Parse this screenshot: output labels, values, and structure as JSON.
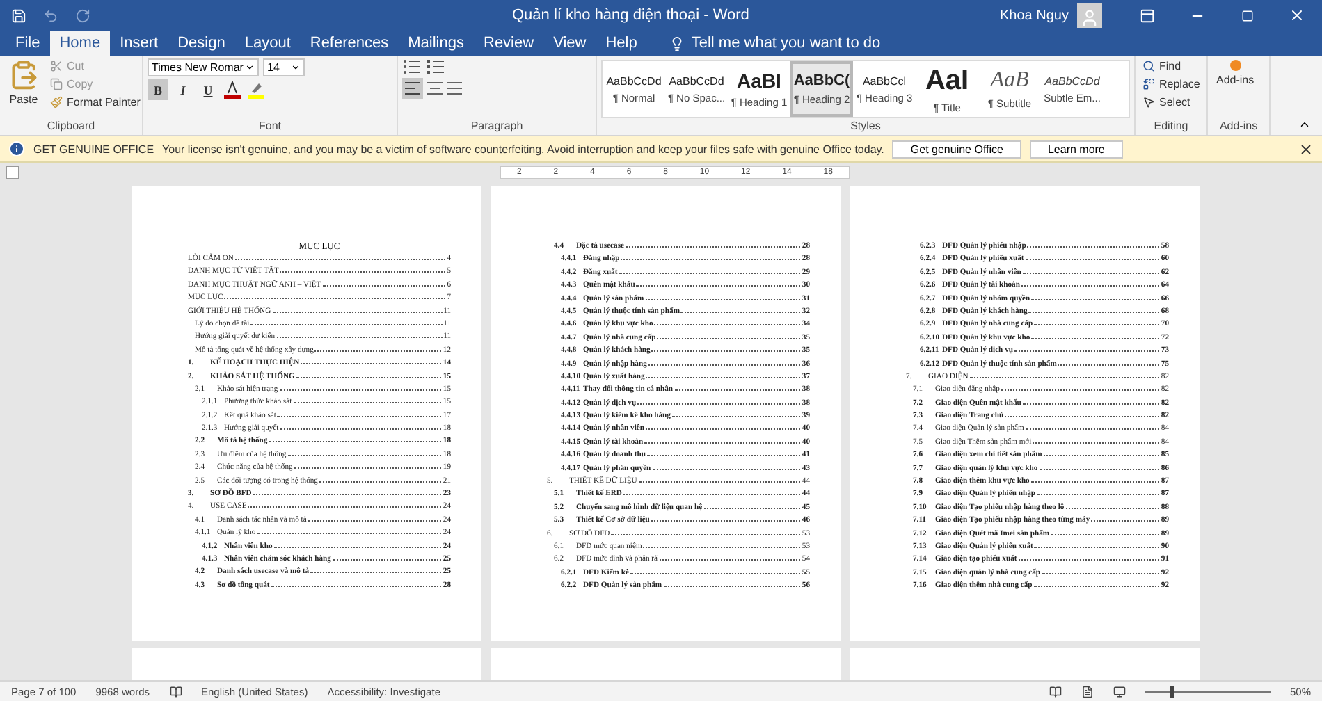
{
  "window": {
    "title": "Quản lí kho hàng điện thoại  -  Word",
    "user": "Khoa Nguy"
  },
  "tabs": [
    {
      "label": "File",
      "selected": false
    },
    {
      "label": "Home",
      "selected": true
    },
    {
      "label": "Insert",
      "selected": false
    },
    {
      "label": "Design",
      "selected": false
    },
    {
      "label": "Layout",
      "selected": false
    },
    {
      "label": "References",
      "selected": false
    },
    {
      "label": "Mailings",
      "selected": false
    },
    {
      "label": "Review",
      "selected": false
    },
    {
      "label": "View",
      "selected": false
    },
    {
      "label": "Help",
      "selected": false
    }
  ],
  "tell_me": "Tell me what you want to do",
  "ribbon": {
    "clipboard": {
      "paste": "Paste",
      "cut": "Cut",
      "copy": "Copy",
      "format_painter": "Format Painter",
      "label": "Clipboard"
    },
    "font": {
      "name": "Times New Romar",
      "size": "14",
      "label": "Font",
      "format": [
        {
          "label": "B",
          "kind": "bold",
          "on": true
        },
        {
          "label": "I",
          "kind": "italic",
          "on": false
        },
        {
          "label": "U",
          "kind": "underline",
          "on": false
        }
      ]
    },
    "paragraph": {
      "label": "Paragraph",
      "align_left": true
    },
    "styles": {
      "label": "Styles",
      "items": [
        {
          "preview": "AaBbCcDd",
          "name": "¶ Normal",
          "kind": "normal",
          "selected": false
        },
        {
          "preview": "AaBbCcDd",
          "name": "¶ No Spac...",
          "kind": "normal",
          "selected": false
        },
        {
          "preview": "AaBI",
          "name": "¶ Heading 1",
          "kind": "heavy",
          "selected": false
        },
        {
          "preview": "AaBbC(",
          "name": "¶ Heading 2",
          "kind": "bold",
          "selected": true
        },
        {
          "preview": "AaBbCcl",
          "name": "¶ Heading 3",
          "kind": "normal",
          "selected": false
        },
        {
          "preview": "AaI",
          "name": "¶ Title",
          "kind": "title",
          "selected": false
        },
        {
          "preview": "AaB",
          "name": "¶ Subtitle",
          "kind": "italic",
          "selected": false
        },
        {
          "preview": "AaBbCcDd",
          "name": "Subtle Em...",
          "kind": "small-italic",
          "selected": false
        }
      ]
    },
    "editing": {
      "label": "Editing",
      "find": "Find",
      "replace": "Replace",
      "select": "Select"
    },
    "addins": {
      "button": "Add-ins",
      "label": "Add-ins"
    }
  },
  "info_bar": {
    "title": "GET GENUINE OFFICE",
    "message": "Your license isn't genuine, and you may be a victim of software counterfeiting. Avoid interruption and keep your files safe with genuine Office today.",
    "buttons": [
      "Get genuine Office",
      "Learn more"
    ]
  },
  "ruler": [
    "2",
    "2",
    "4",
    "6",
    "8",
    "10",
    "12",
    "14",
    "18"
  ],
  "pages": [
    {
      "heading": "MỤC LỤC",
      "entries": [
        {
          "title": "LỜI CẢM ƠN",
          "page": "4",
          "kind": "top",
          "bold": false
        },
        {
          "title": "DANH MỤC TỪ VIẾT TẮT",
          "page": "5",
          "kind": "top",
          "bold": false
        },
        {
          "title": "DANH MỤC THUẬT NGỮ ANH – VIỆT",
          "page": "6",
          "kind": "top",
          "bold": false
        },
        {
          "title": "MỤC LỤC",
          "page": "7",
          "kind": "top",
          "bold": false
        },
        {
          "title": "GIỚI THIỆU HỆ THỐNG",
          "page": "11",
          "kind": "top",
          "bold": false
        },
        {
          "title": "Lý do chọn đề tài",
          "page": "11",
          "kind": "sub",
          "bold": false
        },
        {
          "title": "Hướng giải quyết dự kiến",
          "page": "11",
          "kind": "sub",
          "bold": false
        },
        {
          "title": "Mô tả tổng quát về hệ thống xây dựng",
          "page": "12",
          "kind": "sub",
          "bold": false
        },
        {
          "num": "1.",
          "title": "KẾ HOẠCH THỰC HIỆN",
          "page": "14",
          "kind": "top",
          "bold": true
        },
        {
          "num": "2.",
          "title": "KHẢO SÁT HỆ THỐNG",
          "page": "15",
          "kind": "top",
          "bold": true
        },
        {
          "num": "2.1",
          "title": "Khảo sát hiện trạng",
          "page": "15",
          "kind": "sub",
          "bold": false
        },
        {
          "num": "2.1.1",
          "title": "Phương thức khảo sát",
          "page": "15",
          "kind": "subsub",
          "bold": false
        },
        {
          "num": "2.1.2",
          "title": "Kết quả khảo sát",
          "page": "17",
          "kind": "subsub",
          "bold": false
        },
        {
          "num": "2.1.3",
          "title": "Hướng giải quyết",
          "page": "18",
          "kind": "subsub",
          "bold": false
        },
        {
          "num": "2.2",
          "title": "Mô tả hệ thống",
          "page": "18",
          "kind": "sub",
          "bold": true
        },
        {
          "num": "2.3",
          "title": "Ưu điểm của hệ thống",
          "page": "18",
          "kind": "sub",
          "bold": false
        },
        {
          "num": "2.4",
          "title": "Chức năng của hệ thống",
          "page": "19",
          "kind": "sub",
          "bold": false
        },
        {
          "num": "2.5",
          "title": "Các đối tượng có trong hệ thống",
          "page": "21",
          "kind": "sub",
          "bold": false
        },
        {
          "num": "3.",
          "title": "SƠ ĐỒ BFD",
          "page": "23",
          "kind": "top",
          "bold": true
        },
        {
          "num": "4.",
          "title": "USE CASE",
          "page": "24",
          "kind": "top",
          "bold": false
        },
        {
          "num": "4.1",
          "title": "Danh sách tác nhân và mô tả",
          "page": "24",
          "kind": "sub",
          "bold": false
        },
        {
          "num": "4.1.1",
          "title": "Quản lý kho",
          "page": "24",
          "kind": "sub",
          "bold": false
        },
        {
          "num": "4.1.2",
          "title": "Nhân viên kho",
          "page": "24",
          "kind": "subsub",
          "bold": true
        },
        {
          "num": "4.1.3",
          "title": "Nhân viên chăm sóc khách hàng",
          "page": "25",
          "kind": "subsub",
          "bold": true
        },
        {
          "num": "4.2",
          "title": "Danh sách usecase và mô tả",
          "page": "25",
          "kind": "sub",
          "bold": true
        },
        {
          "num": "4.3",
          "title": "Sơ đồ tổng quát",
          "page": "28",
          "kind": "sub",
          "bold": true
        }
      ]
    },
    {
      "entries": [
        {
          "num": "4.4",
          "title": "Đặc tả usecase",
          "page": "28",
          "kind": "sub",
          "bold": true
        },
        {
          "num": "4.4.1",
          "title": "Đăng nhập",
          "page": "28",
          "kind": "subsub",
          "bold": true
        },
        {
          "num": "4.4.2",
          "title": "Đăng xuất",
          "page": "29",
          "kind": "subsub",
          "bold": true
        },
        {
          "num": "4.4.3",
          "title": "Quên mật khẩu",
          "page": "30",
          "kind": "subsub",
          "bold": true
        },
        {
          "num": "4.4.4",
          "title": "Quản lý sản phẩm",
          "page": "31",
          "kind": "subsub",
          "bold": true
        },
        {
          "num": "4.4.5",
          "title": "Quản lý thuộc tính sản phẩm",
          "page": "32",
          "kind": "subsub",
          "bold": true
        },
        {
          "num": "4.4.6",
          "title": "Quản lý khu vực kho",
          "page": "34",
          "kind": "subsub",
          "bold": true
        },
        {
          "num": "4.4.7",
          "title": "Quản lý nhà cung cấp",
          "page": "35",
          "kind": "subsub",
          "bold": true
        },
        {
          "num": "4.4.8",
          "title": "Quản lý khách hàng",
          "page": "35",
          "kind": "subsub",
          "bold": true
        },
        {
          "num": "4.4.9",
          "title": "Quản lý nhập hàng",
          "page": "36",
          "kind": "subsub",
          "bold": true
        },
        {
          "num": "4.4.10",
          "title": "Quản lý xuất hàng",
          "page": "37",
          "kind": "subsub",
          "bold": true
        },
        {
          "num": "4.4.11",
          "title": "Thay đổi thông tin cá nhân",
          "page": "38",
          "kind": "subsub",
          "bold": true
        },
        {
          "num": "4.4.12",
          "title": "Quản lý dịch vụ",
          "page": "38",
          "kind": "subsub",
          "bold": true
        },
        {
          "num": "4.4.13",
          "title": "Quản lý kiểm kê kho hàng",
          "page": "39",
          "kind": "subsub",
          "bold": true
        },
        {
          "num": "4.4.14",
          "title": "Quản lý nhân viên",
          "page": "40",
          "kind": "subsub",
          "bold": true
        },
        {
          "num": "4.4.15",
          "title": "Quản lý tài khoản",
          "page": "40",
          "kind": "subsub",
          "bold": true
        },
        {
          "num": "4.4.16",
          "title": "Quản lý doanh thu",
          "page": "41",
          "kind": "subsub",
          "bold": true
        },
        {
          "num": "4.4.17",
          "title": "Quản lý phân quyền",
          "page": "43",
          "kind": "subsub",
          "bold": true
        },
        {
          "num": "5.",
          "title": "THIẾT KẾ DỮ LIỆU",
          "page": "44",
          "kind": "top",
          "bold": false
        },
        {
          "num": "5.1",
          "title": "Thiết kế ERD",
          "page": "44",
          "kind": "sub",
          "bold": true
        },
        {
          "num": "5.2",
          "title": "Chuyển sang mô hình dữ liệu quan hệ",
          "page": "45",
          "kind": "sub",
          "bold": true
        },
        {
          "num": "5.3",
          "title": "Thiết kế Cơ sở dữ liệu",
          "page": "46",
          "kind": "sub",
          "bold": true
        },
        {
          "num": "6.",
          "title": "SƠ ĐỒ DFD",
          "page": "53",
          "kind": "top",
          "bold": false
        },
        {
          "num": "6.1",
          "title": "DFD mức quan niệm",
          "page": "53",
          "kind": "sub",
          "bold": false
        },
        {
          "num": "6.2",
          "title": "DFD mức đỉnh và phân rã",
          "page": "54",
          "kind": "sub",
          "bold": false
        },
        {
          "num": "6.2.1",
          "title": "DFD Kiểm kê",
          "page": "55",
          "kind": "subsub",
          "bold": true
        },
        {
          "num": "6.2.2",
          "title": "DFD Quản lý sản phẩm",
          "page": "56",
          "kind": "subsub",
          "bold": true
        }
      ]
    },
    {
      "entries": [
        {
          "num": "6.2.3",
          "title": "DFD Quản lý phiếu nhập",
          "page": "58",
          "kind": "subsub",
          "bold": true
        },
        {
          "num": "6.2.4",
          "title": "DFD Quản lý phiếu xuất",
          "page": "60",
          "kind": "subsub",
          "bold": true
        },
        {
          "num": "6.2.5",
          "title": "DFD Quản lý nhân viên",
          "page": "62",
          "kind": "subsub",
          "bold": true
        },
        {
          "num": "6.2.6",
          "title": "DFD Quản lý tài khoản",
          "page": "64",
          "kind": "subsub",
          "bold": true
        },
        {
          "num": "6.2.7",
          "title": "DFD Quản lý nhóm quyền",
          "page": "66",
          "kind": "subsub",
          "bold": true
        },
        {
          "num": "6.2.8",
          "title": "DFD Quản lý khách hàng",
          "page": "68",
          "kind": "subsub",
          "bold": true
        },
        {
          "num": "6.2.9",
          "title": "DFD Quản lý nhà cung cấp",
          "page": "70",
          "kind": "subsub",
          "bold": true
        },
        {
          "num": "6.2.10",
          "title": "DFD Quản lý khu vực kho",
          "page": "72",
          "kind": "subsub",
          "bold": true
        },
        {
          "num": "6.2.11",
          "title": "DFD Quản lý dịch vụ",
          "page": "73",
          "kind": "subsub",
          "bold": true
        },
        {
          "num": "6.2.12",
          "title": "DFD Quản lý thuộc tính sản phẩm",
          "page": "75",
          "kind": "subsub",
          "bold": true
        },
        {
          "num": "7.",
          "title": "GIAO DIỆN",
          "page": "82",
          "kind": "top",
          "bold": false
        },
        {
          "num": "7.1",
          "title": "Giao diện đăng nhập",
          "page": "82",
          "kind": "sub",
          "bold": false
        },
        {
          "num": "7.2",
          "title": "Giao diện Quên mật khẩu",
          "page": "82",
          "kind": "sub",
          "bold": true
        },
        {
          "num": "7.3",
          "title": "Giao diện Trang chủ",
          "page": "82",
          "kind": "sub",
          "bold": true
        },
        {
          "num": "7.4",
          "title": "Giao diện Quản lý sản phẩm",
          "page": "84",
          "kind": "sub",
          "bold": false
        },
        {
          "num": "7.5",
          "title": "Giao diện Thêm sản phẩm mới",
          "page": "84",
          "kind": "sub",
          "bold": false
        },
        {
          "num": "7.6",
          "title": "Giao diện xem chi tiết sản phẩm",
          "page": "85",
          "kind": "sub",
          "bold": true
        },
        {
          "num": "7.7",
          "title": "Giao diện quản lý khu vực kho",
          "page": "86",
          "kind": "sub",
          "bold": true
        },
        {
          "num": "7.8",
          "title": "Giao diện thêm khu vực kho",
          "page": "87",
          "kind": "sub",
          "bold": true
        },
        {
          "num": "7.9",
          "title": "Giao diện Quản lý phiếu nhập",
          "page": "87",
          "kind": "sub",
          "bold": true
        },
        {
          "num": "7.10",
          "title": "Giao diện Tạo phiếu nhập hàng theo lô",
          "page": "88",
          "kind": "sub",
          "bold": true
        },
        {
          "num": "7.11",
          "title": "Giao diện Tạo phiếu nhập hàng theo từng máy",
          "page": "89",
          "kind": "sub",
          "bold": true
        },
        {
          "num": "7.12",
          "title": "Giao diện Quét mã Imei sản phẩm",
          "page": "89",
          "kind": "sub",
          "bold": true
        },
        {
          "num": "7.13",
          "title": "Giao diện Quản lý phiếu xuất",
          "page": "90",
          "kind": "sub",
          "bold": true
        },
        {
          "num": "7.14",
          "title": "Giao diện tạo phiếu xuất",
          "page": "91",
          "kind": "sub",
          "bold": true
        },
        {
          "num": "7.15",
          "title": "Giao diện quản lý nhà cung cấp",
          "page": "92",
          "kind": "sub",
          "bold": true
        },
        {
          "num": "7.16",
          "title": "Giao diện thêm nhà cung cấp",
          "page": "92",
          "kind": "sub",
          "bold": true
        }
      ]
    }
  ],
  "status_bar": {
    "page": "Page 7 of 100",
    "words": "9968 words",
    "language": "English (United States)",
    "accessibility": "Accessibility: Investigate",
    "zoom": "50%",
    "zoom_slider": {
      "level": 0.2
    }
  }
}
